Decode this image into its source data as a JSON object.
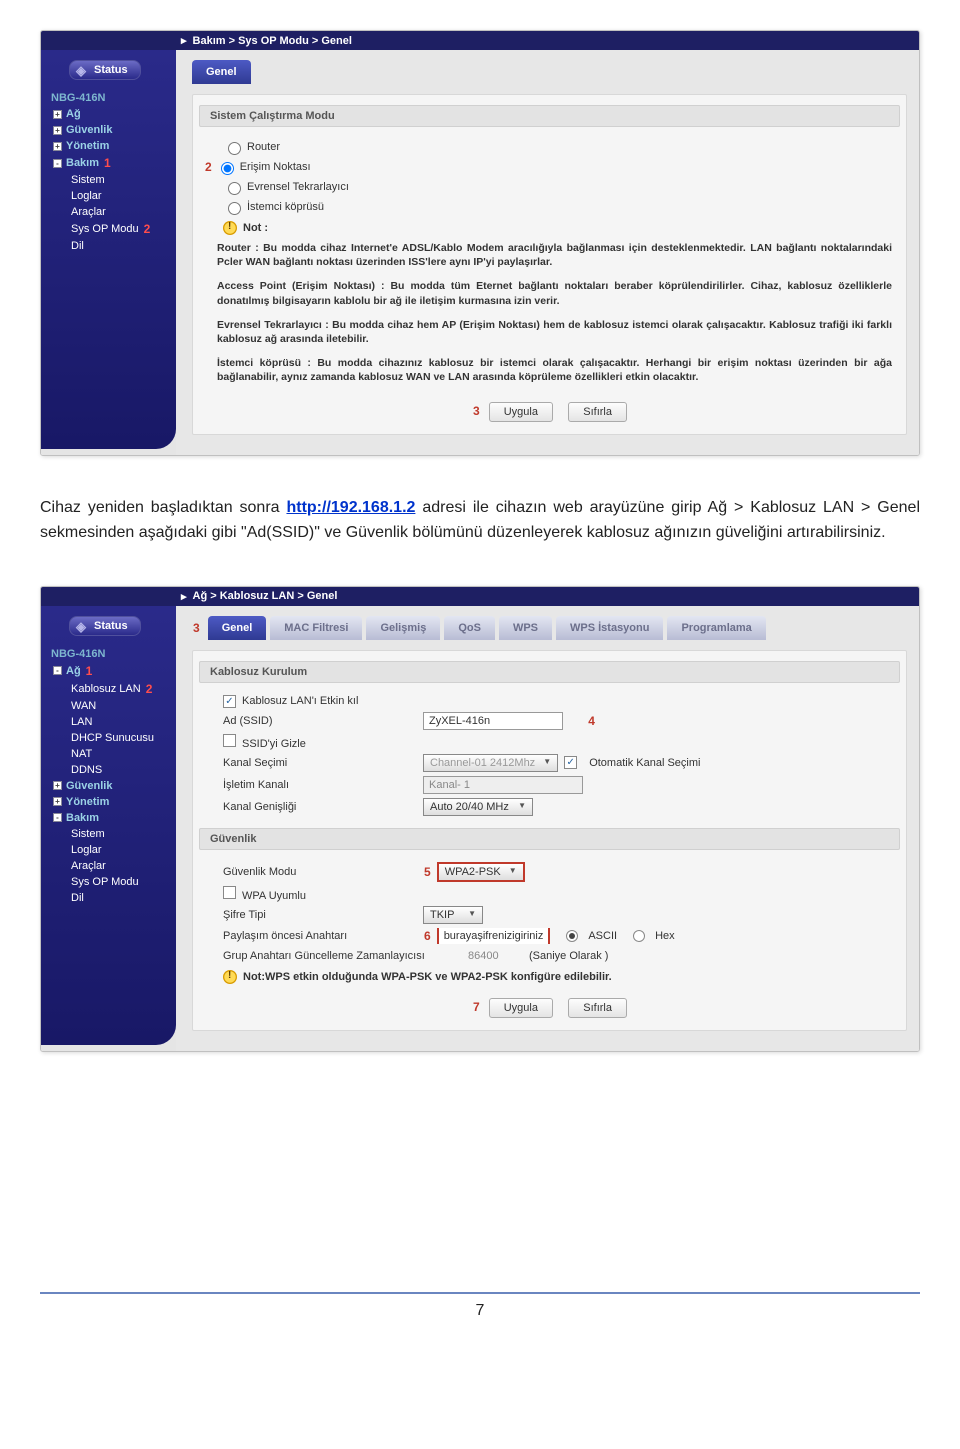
{
  "footer_page": "7",
  "doc_paragraph": {
    "prefix": "Cihaz yeniden başladıktan sonra ",
    "link_text": "http://192.168.1.2",
    "suffix": " adresi ile cihazın web arayüzüne girip Ağ > Kablosuz LAN > Genel sekmesinden aşağıdaki gibi \"Ad(SSID)\" ve Güvenlik bölümünü düzenleyerek kablosuz ağınızın güveliğini artırabilirsiniz."
  },
  "screenshot1": {
    "breadcrumb": "Bakım > Sys OP Modu > Genel",
    "status": "Status",
    "model": "NBG-416N",
    "nav": {
      "ag": "Ağ",
      "guvenlik": "Güvenlik",
      "yonetim": "Yönetim",
      "bakim": "Bakım",
      "sistem": "Sistem",
      "loglar": "Loglar",
      "araclar": "Araçlar",
      "sysop": "Sys OP Modu",
      "dil": "Dil"
    },
    "tab_genel": "Genel",
    "section": "Sistem Çalıştırma Modu",
    "radios": {
      "router": "Router",
      "erisim": "Erişim Noktası",
      "evrensel": "Evrensel Tekrarlayıcı",
      "istemci": "İstemci köprüsü"
    },
    "note_label": "Not :",
    "p_router": "Router : Bu modda cihaz Internet'e ADSL/Kablo Modem aracılığıyla bağlanması için desteklenmektedir. LAN bağlantı noktalarındaki Pcler WAN bağlantı noktası üzerinden ISS'lere aynı IP'yi paylaşırlar.",
    "p_access": "Access Point (Erişim Noktası) : Bu modda tüm Eternet bağlantı noktaları beraber köprülendirilirler. Cihaz, kablosuz özelliklerle donatılmış bilgisayarın kablolu bir ağ ile iletişim kurmasına izin verir.",
    "p_evrensel": "Evrensel Tekrarlayıcı : Bu modda cihaz hem AP (Erişim Noktası) hem de kablosuz istemci olarak çalışacaktır. Kablosuz trafiği iki farklı kablosuz ağ arasında iletebilir.",
    "p_istemci": "İstemci köprüsü : Bu modda cihazınız kablosuz bir istemci olarak çalışacaktır. Herhangi bir erişim noktası üzerinden bir ağa bağlanabilir, aynız zamanda kablosuz WAN ve LAN arasında köprüleme özellikleri etkin olacaktır.",
    "btn_apply": "Uygula",
    "btn_reset": "Sıfırla",
    "markers": {
      "m1": "1",
      "m2": "2",
      "m2b": "2",
      "m3": "3"
    }
  },
  "screenshot2": {
    "breadcrumb": "Ağ > Kablosuz LAN > Genel",
    "status": "Status",
    "model": "NBG-416N",
    "nav": {
      "ag": "Ağ",
      "kablosuzlan": "Kablosuz LAN",
      "wan": "WAN",
      "lan": "LAN",
      "dhcp": "DHCP Sunucusu",
      "nat": "NAT",
      "ddns": "DDNS",
      "guvenlik": "Güvenlik",
      "yonetim": "Yönetim",
      "bakim": "Bakım",
      "sistem": "Sistem",
      "loglar": "Loglar",
      "araclar": "Araçlar",
      "sysop": "Sys OP Modu",
      "dil": "Dil"
    },
    "tabs": {
      "genel": "Genel",
      "mac": "MAC Filtresi",
      "gelismis": "Gelişmiş",
      "qos": "QoS",
      "wps": "WPS",
      "wps_ist": "WPS İstasyonu",
      "program": "Programlama"
    },
    "sections": {
      "kablosuz": "Kablosuz Kurulum",
      "guvenlik": "Güvenlik"
    },
    "fields": {
      "etkin": "Kablosuz LAN'ı Etkin kıl",
      "ssid_label": "Ad (SSID)",
      "ssid_value": "ZyXEL-416n",
      "ssid_gizle": "SSID'yi Gizle",
      "kanal_sec": "Kanal Seçimi",
      "kanal_val": "Channel-01 2412Mhz",
      "oto": "Otomatik Kanal Seçimi",
      "isletim": "İşletim Kanalı",
      "isletim_val": "Kanal- 1",
      "kanal_genis": "Kanal Genişliği",
      "kanal_genis_val": "Auto 20/40 MHz",
      "guv_modu": "Güvenlik Modu",
      "guv_modu_val": "WPA2-PSK",
      "wpa_uyum": "WPA Uyumlu",
      "sifre_tipi": "Şifre Tipi",
      "sifre_tipi_val": "TKIP",
      "presk": "Paylaşım öncesi Anahtarı",
      "presk_val": "burayaşifrenizigiriniz",
      "ascii": "ASCII",
      "hex": "Hex",
      "grup": "Grup Anahtarı Güncelleme Zamanlayıcısı",
      "grup_val": "86400",
      "grup_unit": "(Saniye Olarak )",
      "wps_note": "Not:WPS etkin olduğunda WPA-PSK ve WPA2-PSK konfigüre edilebilir."
    },
    "btn_apply": "Uygula",
    "btn_reset": "Sıfırla",
    "markers": {
      "m1": "1",
      "m2": "2",
      "m3": "3",
      "m4": "4",
      "m5": "5",
      "m6": "6",
      "m7": "7"
    }
  }
}
